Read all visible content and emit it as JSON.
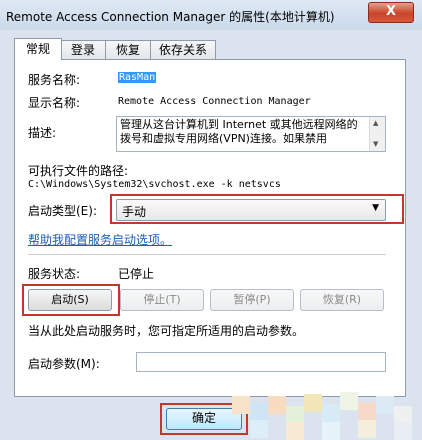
{
  "window": {
    "title": "Remote Access Connection Manager 的属性(本地计算机)",
    "close_symbol": "X"
  },
  "tabs": [
    {
      "label": "常规",
      "active": true
    },
    {
      "label": "登录",
      "active": false
    },
    {
      "label": "恢复",
      "active": false
    },
    {
      "label": "依存关系",
      "active": false
    }
  ],
  "general": {
    "service_name_label": "服务名称:",
    "service_name_value": "RasMan",
    "display_name_label": "显示名称:",
    "display_name_value": "Remote Access Connection Manager",
    "description_label": "描述:",
    "description_value": "管理从这台计算机到 Internet 或其他远程网络的拨号和虚拟专用网络(VPN)连接。如果禁用",
    "exe_path_label": "可执行文件的路径:",
    "exe_path_value": "C:\\Windows\\System32\\svchost.exe -k netsvcs",
    "startup_type_label": "启动类型(E):",
    "startup_type_value": "手动",
    "help_link": "帮助我配置服务启动选项。",
    "service_status_label": "服务状态:",
    "service_status_value": "已停止",
    "start_button": "启动(S)",
    "stop_button": "停止(T)",
    "pause_button": "暂停(P)",
    "resume_button": "恢复(R)",
    "hint_text": "当从此处启动服务时，您可指定所适用的启动参数。",
    "start_params_label": "启动参数(M):",
    "start_params_value": ""
  },
  "footer": {
    "ok_button": "确定"
  },
  "colors": {
    "highlight_box": "#c0392b",
    "link": "#1a5fb4",
    "selection": "#3399ff"
  }
}
